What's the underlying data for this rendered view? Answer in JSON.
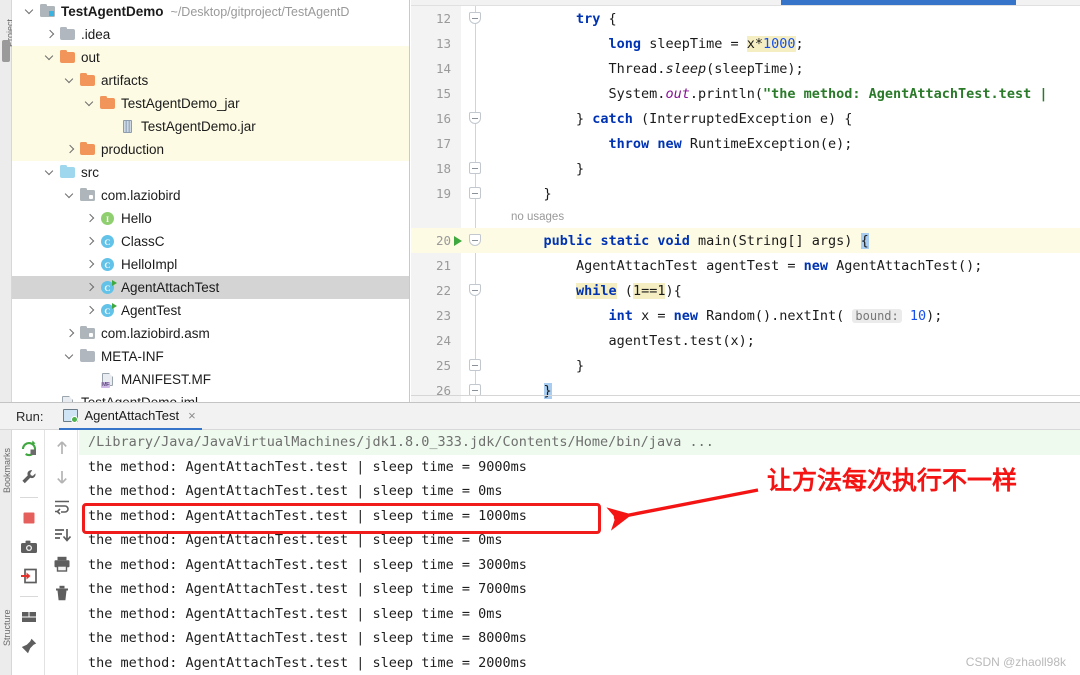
{
  "sidebar_strips": {
    "left_top_label": "Project",
    "left_bottom_label": "Bookmarks",
    "structure_label": "Structure"
  },
  "project_tree": {
    "rows": [
      {
        "indent": 0,
        "chev": "d",
        "icon": "project-root-icon",
        "label": "TestAgentDemo",
        "bold": true,
        "sub": "~/Desktop/gitproject/TestAgentD",
        "hl": "none"
      },
      {
        "indent": 1,
        "chev": "r",
        "icon": "folder-gray-icon",
        "label": ".idea",
        "bold": false,
        "sub": "",
        "hl": "none"
      },
      {
        "indent": 1,
        "chev": "d",
        "icon": "folder-orange-icon",
        "label": "out",
        "bold": false,
        "sub": "",
        "hl": "yellow"
      },
      {
        "indent": 2,
        "chev": "d",
        "icon": "folder-orange-icon",
        "label": "artifacts",
        "bold": false,
        "sub": "",
        "hl": "yellow"
      },
      {
        "indent": 3,
        "chev": "d",
        "icon": "folder-orange-icon",
        "label": "TestAgentDemo_jar",
        "bold": false,
        "sub": "",
        "hl": "yellow"
      },
      {
        "indent": 4,
        "chev": "",
        "icon": "jar-file-icon",
        "label": "TestAgentDemo.jar",
        "bold": false,
        "sub": "",
        "hl": "yellow"
      },
      {
        "indent": 2,
        "chev": "r",
        "icon": "folder-orange-icon",
        "label": "production",
        "bold": false,
        "sub": "",
        "hl": "yellow"
      },
      {
        "indent": 1,
        "chev": "d",
        "icon": "folder-blue-icon",
        "label": "src",
        "bold": false,
        "sub": "",
        "hl": "none"
      },
      {
        "indent": 2,
        "chev": "d",
        "icon": "package-icon",
        "label": "com.laziobird",
        "bold": false,
        "sub": "",
        "hl": "none"
      },
      {
        "indent": 3,
        "chev": "r",
        "icon": "interface-icon",
        "label": "Hello",
        "bold": false,
        "sub": "",
        "hl": "none"
      },
      {
        "indent": 3,
        "chev": "r",
        "icon": "class-icon",
        "label": "ClassC",
        "bold": false,
        "sub": "",
        "hl": "none"
      },
      {
        "indent": 3,
        "chev": "r",
        "icon": "class-icon",
        "label": "HelloImpl",
        "bold": false,
        "sub": "",
        "hl": "none"
      },
      {
        "indent": 3,
        "chev": "r",
        "icon": "runnable-class-icon",
        "label": "AgentAttachTest",
        "bold": false,
        "sub": "",
        "hl": "selected"
      },
      {
        "indent": 3,
        "chev": "r",
        "icon": "runnable-class-icon",
        "label": "AgentTest",
        "bold": false,
        "sub": "",
        "hl": "none"
      },
      {
        "indent": 2,
        "chev": "r",
        "icon": "package-icon",
        "label": "com.laziobird.asm",
        "bold": false,
        "sub": "",
        "hl": "none"
      },
      {
        "indent": 2,
        "chev": "d",
        "icon": "folder-gray-icon",
        "label": "META-INF",
        "bold": false,
        "sub": "",
        "hl": "none"
      },
      {
        "indent": 3,
        "chev": "",
        "icon": "manifest-file-icon",
        "label": "MANIFEST.MF",
        "bold": false,
        "sub": "",
        "hl": "none"
      },
      {
        "indent": 1,
        "chev": "",
        "icon": "iml-file-icon",
        "label": "TestAgentDemo.iml",
        "bold": false,
        "sub": "",
        "hl": "none"
      }
    ]
  },
  "editor": {
    "inlay_no_usages": "no usages",
    "lines": [
      {
        "num": "12",
        "fold": "open",
        "run": false,
        "hi": false,
        "tokens": [
          {
            "t": "        ",
            "c": ""
          },
          {
            "t": "try",
            "c": "kw"
          },
          {
            "t": " {",
            "c": ""
          }
        ]
      },
      {
        "num": "13",
        "fold": "",
        "run": false,
        "hi": false,
        "tokens": [
          {
            "t": "            ",
            "c": ""
          },
          {
            "t": "long",
            "c": "kw"
          },
          {
            "t": " sleepTime = ",
            "c": ""
          },
          {
            "t": "x*",
            "c": "hlt"
          },
          {
            "t": "1000",
            "c": "num hlt"
          },
          {
            "t": ";",
            "c": ""
          }
        ]
      },
      {
        "num": "14",
        "fold": "",
        "run": false,
        "hi": false,
        "tokens": [
          {
            "t": "            Thread.",
            "c": ""
          },
          {
            "t": "sleep",
            "c": "mth"
          },
          {
            "t": "(sleepTime);",
            "c": ""
          }
        ]
      },
      {
        "num": "15",
        "fold": "",
        "run": false,
        "hi": false,
        "tokens": [
          {
            "t": "            System.",
            "c": ""
          },
          {
            "t": "out",
            "c": "fld"
          },
          {
            "t": ".println(",
            "c": ""
          },
          {
            "t": "\"the method: AgentAttachTest.test |",
            "c": "str"
          }
        ]
      },
      {
        "num": "16",
        "fold": "open",
        "run": false,
        "hi": false,
        "tokens": [
          {
            "t": "        } ",
            "c": ""
          },
          {
            "t": "catch",
            "c": "kw"
          },
          {
            "t": " (InterruptedException e) {",
            "c": ""
          }
        ]
      },
      {
        "num": "17",
        "fold": "",
        "run": false,
        "hi": false,
        "tokens": [
          {
            "t": "            ",
            "c": ""
          },
          {
            "t": "throw",
            "c": "kw"
          },
          {
            "t": " ",
            "c": ""
          },
          {
            "t": "new",
            "c": "kw"
          },
          {
            "t": " RuntimeException(e);",
            "c": ""
          }
        ]
      },
      {
        "num": "18",
        "fold": "close",
        "run": false,
        "hi": false,
        "tokens": [
          {
            "t": "        }",
            "c": ""
          }
        ]
      },
      {
        "num": "19",
        "fold": "close",
        "run": false,
        "hi": false,
        "tokens": [
          {
            "t": "    }",
            "c": ""
          }
        ]
      },
      {
        "num": "20",
        "fold": "open",
        "run": true,
        "hi": true,
        "tokens": [
          {
            "t": "    ",
            "c": ""
          },
          {
            "t": "public",
            "c": "kw"
          },
          {
            "t": " ",
            "c": ""
          },
          {
            "t": "static",
            "c": "kw"
          },
          {
            "t": " ",
            "c": ""
          },
          {
            "t": "void",
            "c": "kw"
          },
          {
            "t": " main(String[] args) ",
            "c": ""
          },
          {
            "t": "{",
            "c": "caretsel"
          }
        ]
      },
      {
        "num": "21",
        "fold": "",
        "run": false,
        "hi": false,
        "tokens": [
          {
            "t": "        AgentAttachTest agentTest = ",
            "c": ""
          },
          {
            "t": "new",
            "c": "kw"
          },
          {
            "t": " AgentAttachTest();",
            "c": ""
          }
        ]
      },
      {
        "num": "22",
        "fold": "open",
        "run": false,
        "hi": false,
        "tokens": [
          {
            "t": "        ",
            "c": ""
          },
          {
            "t": "while",
            "c": "kw hlt"
          },
          {
            "t": " (",
            "c": ""
          },
          {
            "t": "1==1",
            "c": "hlt"
          },
          {
            "t": "){",
            "c": ""
          }
        ]
      },
      {
        "num": "23",
        "fold": "",
        "run": false,
        "hi": false,
        "tokens": [
          {
            "t": "            ",
            "c": ""
          },
          {
            "t": "int",
            "c": "kw"
          },
          {
            "t": " x = ",
            "c": ""
          },
          {
            "t": "new",
            "c": "kw"
          },
          {
            "t": " Random().nextInt( ",
            "c": ""
          },
          {
            "t": "bound:",
            "c": "hint"
          },
          {
            "t": " ",
            "c": ""
          },
          {
            "t": "10",
            "c": "num"
          },
          {
            "t": ");",
            "c": ""
          }
        ]
      },
      {
        "num": "24",
        "fold": "",
        "run": false,
        "hi": false,
        "tokens": [
          {
            "t": "            agentTest.test(x);",
            "c": ""
          }
        ]
      },
      {
        "num": "25",
        "fold": "close",
        "run": false,
        "hi": false,
        "tokens": [
          {
            "t": "        }",
            "c": ""
          }
        ]
      },
      {
        "num": "26",
        "fold": "close",
        "run": false,
        "hi": false,
        "tokens": [
          {
            "t": "    ",
            "c": ""
          },
          {
            "t": "}",
            "c": "caretsel"
          }
        ]
      }
    ]
  },
  "run_panel": {
    "run_label": "Run:",
    "tab_name": "AgentAttachTest",
    "close_glyph": "×",
    "toolbar_left": [
      {
        "name": "rerun-button",
        "title": "Rerun"
      },
      {
        "name": "settings-wrench-button",
        "title": "Modify Run Configuration"
      },
      {
        "name": "stop-button",
        "title": "Stop"
      },
      {
        "name": "camera-button",
        "title": "Screenshot"
      },
      {
        "name": "export-button",
        "title": "Export"
      },
      {
        "name": "layout-button",
        "title": "Layout Settings"
      },
      {
        "name": "pin-button",
        "title": "Pin Tab"
      }
    ],
    "toolbar_right": [
      {
        "name": "up-arrow-button",
        "title": "Previous Occurrence"
      },
      {
        "name": "down-arrow-button",
        "title": "Next Occurrence"
      },
      {
        "name": "soft-wrap-button",
        "title": "Soft-Wrap"
      },
      {
        "name": "scroll-to-end-button",
        "title": "Scroll to End"
      },
      {
        "name": "print-button",
        "title": "Print"
      },
      {
        "name": "trash-button",
        "title": "Clear All"
      }
    ],
    "console_lines": [
      "/Library/Java/JavaVirtualMachines/jdk1.8.0_333.jdk/Contents/Home/bin/java ...",
      "the method: AgentAttachTest.test | sleep time = 9000ms",
      "the method: AgentAttachTest.test | sleep time = 0ms",
      "the method: AgentAttachTest.test | sleep time = 1000ms",
      "the method: AgentAttachTest.test | sleep time = 0ms",
      "the method: AgentAttachTest.test | sleep time = 3000ms",
      "the method: AgentAttachTest.test | sleep time = 7000ms",
      "the method: AgentAttachTest.test | sleep time = 0ms",
      "the method: AgentAttachTest.test | sleep time = 8000ms",
      "the method: AgentAttachTest.test | sleep time = 2000ms"
    ]
  },
  "annotation": {
    "text": "让方法每次执行不一样",
    "color": "#f41414"
  },
  "watermark": {
    "text": "CSDN @zhaoll98k"
  },
  "colors": {
    "accent_blue": "#3574c8",
    "highlight_yellow": "#fdfbe4",
    "selection_gray": "#d4d4d4",
    "console_first_bg": "#edfaed",
    "annotation_red": "#f01c1c",
    "folder_orange": "#f2955a",
    "folder_blue": "#9fd7ee"
  }
}
